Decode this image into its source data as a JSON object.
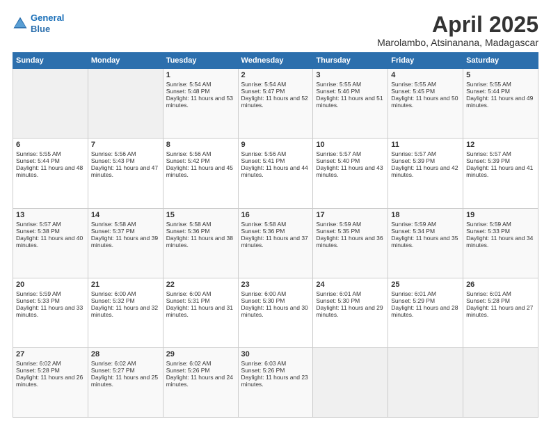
{
  "logo": {
    "line1": "General",
    "line2": "Blue"
  },
  "title": "April 2025",
  "location": "Marolambo, Atsinanana, Madagascar",
  "weekdays": [
    "Sunday",
    "Monday",
    "Tuesday",
    "Wednesday",
    "Thursday",
    "Friday",
    "Saturday"
  ],
  "weeks": [
    [
      {
        "day": "",
        "sunrise": "",
        "sunset": "",
        "daylight": ""
      },
      {
        "day": "",
        "sunrise": "",
        "sunset": "",
        "daylight": ""
      },
      {
        "day": "1",
        "sunrise": "Sunrise: 5:54 AM",
        "sunset": "Sunset: 5:48 PM",
        "daylight": "Daylight: 11 hours and 53 minutes."
      },
      {
        "day": "2",
        "sunrise": "Sunrise: 5:54 AM",
        "sunset": "Sunset: 5:47 PM",
        "daylight": "Daylight: 11 hours and 52 minutes."
      },
      {
        "day": "3",
        "sunrise": "Sunrise: 5:55 AM",
        "sunset": "Sunset: 5:46 PM",
        "daylight": "Daylight: 11 hours and 51 minutes."
      },
      {
        "day": "4",
        "sunrise": "Sunrise: 5:55 AM",
        "sunset": "Sunset: 5:45 PM",
        "daylight": "Daylight: 11 hours and 50 minutes."
      },
      {
        "day": "5",
        "sunrise": "Sunrise: 5:55 AM",
        "sunset": "Sunset: 5:44 PM",
        "daylight": "Daylight: 11 hours and 49 minutes."
      }
    ],
    [
      {
        "day": "6",
        "sunrise": "Sunrise: 5:55 AM",
        "sunset": "Sunset: 5:44 PM",
        "daylight": "Daylight: 11 hours and 48 minutes."
      },
      {
        "day": "7",
        "sunrise": "Sunrise: 5:56 AM",
        "sunset": "Sunset: 5:43 PM",
        "daylight": "Daylight: 11 hours and 47 minutes."
      },
      {
        "day": "8",
        "sunrise": "Sunrise: 5:56 AM",
        "sunset": "Sunset: 5:42 PM",
        "daylight": "Daylight: 11 hours and 45 minutes."
      },
      {
        "day": "9",
        "sunrise": "Sunrise: 5:56 AM",
        "sunset": "Sunset: 5:41 PM",
        "daylight": "Daylight: 11 hours and 44 minutes."
      },
      {
        "day": "10",
        "sunrise": "Sunrise: 5:57 AM",
        "sunset": "Sunset: 5:40 PM",
        "daylight": "Daylight: 11 hours and 43 minutes."
      },
      {
        "day": "11",
        "sunrise": "Sunrise: 5:57 AM",
        "sunset": "Sunset: 5:39 PM",
        "daylight": "Daylight: 11 hours and 42 minutes."
      },
      {
        "day": "12",
        "sunrise": "Sunrise: 5:57 AM",
        "sunset": "Sunset: 5:39 PM",
        "daylight": "Daylight: 11 hours and 41 minutes."
      }
    ],
    [
      {
        "day": "13",
        "sunrise": "Sunrise: 5:57 AM",
        "sunset": "Sunset: 5:38 PM",
        "daylight": "Daylight: 11 hours and 40 minutes."
      },
      {
        "day": "14",
        "sunrise": "Sunrise: 5:58 AM",
        "sunset": "Sunset: 5:37 PM",
        "daylight": "Daylight: 11 hours and 39 minutes."
      },
      {
        "day": "15",
        "sunrise": "Sunrise: 5:58 AM",
        "sunset": "Sunset: 5:36 PM",
        "daylight": "Daylight: 11 hours and 38 minutes."
      },
      {
        "day": "16",
        "sunrise": "Sunrise: 5:58 AM",
        "sunset": "Sunset: 5:36 PM",
        "daylight": "Daylight: 11 hours and 37 minutes."
      },
      {
        "day": "17",
        "sunrise": "Sunrise: 5:59 AM",
        "sunset": "Sunset: 5:35 PM",
        "daylight": "Daylight: 11 hours and 36 minutes."
      },
      {
        "day": "18",
        "sunrise": "Sunrise: 5:59 AM",
        "sunset": "Sunset: 5:34 PM",
        "daylight": "Daylight: 11 hours and 35 minutes."
      },
      {
        "day": "19",
        "sunrise": "Sunrise: 5:59 AM",
        "sunset": "Sunset: 5:33 PM",
        "daylight": "Daylight: 11 hours and 34 minutes."
      }
    ],
    [
      {
        "day": "20",
        "sunrise": "Sunrise: 5:59 AM",
        "sunset": "Sunset: 5:33 PM",
        "daylight": "Daylight: 11 hours and 33 minutes."
      },
      {
        "day": "21",
        "sunrise": "Sunrise: 6:00 AM",
        "sunset": "Sunset: 5:32 PM",
        "daylight": "Daylight: 11 hours and 32 minutes."
      },
      {
        "day": "22",
        "sunrise": "Sunrise: 6:00 AM",
        "sunset": "Sunset: 5:31 PM",
        "daylight": "Daylight: 11 hours and 31 minutes."
      },
      {
        "day": "23",
        "sunrise": "Sunrise: 6:00 AM",
        "sunset": "Sunset: 5:30 PM",
        "daylight": "Daylight: 11 hours and 30 minutes."
      },
      {
        "day": "24",
        "sunrise": "Sunrise: 6:01 AM",
        "sunset": "Sunset: 5:30 PM",
        "daylight": "Daylight: 11 hours and 29 minutes."
      },
      {
        "day": "25",
        "sunrise": "Sunrise: 6:01 AM",
        "sunset": "Sunset: 5:29 PM",
        "daylight": "Daylight: 11 hours and 28 minutes."
      },
      {
        "day": "26",
        "sunrise": "Sunrise: 6:01 AM",
        "sunset": "Sunset: 5:28 PM",
        "daylight": "Daylight: 11 hours and 27 minutes."
      }
    ],
    [
      {
        "day": "27",
        "sunrise": "Sunrise: 6:02 AM",
        "sunset": "Sunset: 5:28 PM",
        "daylight": "Daylight: 11 hours and 26 minutes."
      },
      {
        "day": "28",
        "sunrise": "Sunrise: 6:02 AM",
        "sunset": "Sunset: 5:27 PM",
        "daylight": "Daylight: 11 hours and 25 minutes."
      },
      {
        "day": "29",
        "sunrise": "Sunrise: 6:02 AM",
        "sunset": "Sunset: 5:26 PM",
        "daylight": "Daylight: 11 hours and 24 minutes."
      },
      {
        "day": "30",
        "sunrise": "Sunrise: 6:03 AM",
        "sunset": "Sunset: 5:26 PM",
        "daylight": "Daylight: 11 hours and 23 minutes."
      },
      {
        "day": "",
        "sunrise": "",
        "sunset": "",
        "daylight": ""
      },
      {
        "day": "",
        "sunrise": "",
        "sunset": "",
        "daylight": ""
      },
      {
        "day": "",
        "sunrise": "",
        "sunset": "",
        "daylight": ""
      }
    ]
  ]
}
